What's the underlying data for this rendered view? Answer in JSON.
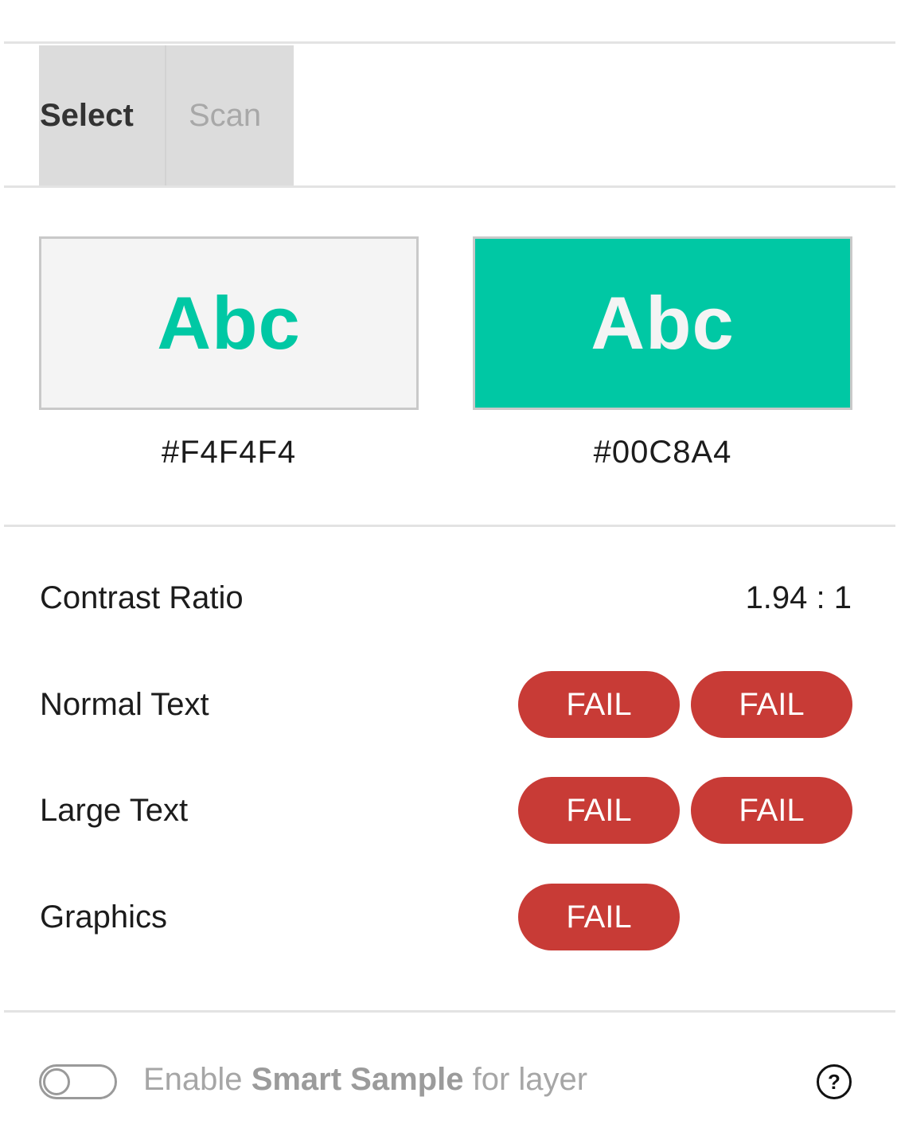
{
  "tabs": {
    "select": "Select",
    "scan": "Scan"
  },
  "swatches": {
    "background": {
      "sample": "Abc",
      "hex": "#F4F4F4",
      "fill": "#F4F4F4",
      "text_color": "#00C8A4"
    },
    "foreground": {
      "sample": "Abc",
      "hex": "#00C8A4",
      "fill": "#00C8A4",
      "text_color": "#F4F4F4"
    }
  },
  "results": {
    "contrast_label": "Contrast Ratio",
    "contrast_value": "1.94 : 1",
    "normal_text": {
      "label": "Normal Text",
      "aa": "FAIL",
      "aaa": "FAIL"
    },
    "large_text": {
      "label": "Large Text",
      "aa": "FAIL",
      "aaa": "FAIL"
    },
    "graphics": {
      "label": "Graphics",
      "aa": "FAIL"
    }
  },
  "footer": {
    "enable": "Enable",
    "smart_sample": "Smart Sample",
    "for_layer": "for layer",
    "help": "?",
    "toggle_on": false
  },
  "colors": {
    "fail": "#C83B36",
    "accent": "#00C8A4",
    "light": "#F4F4F4"
  }
}
